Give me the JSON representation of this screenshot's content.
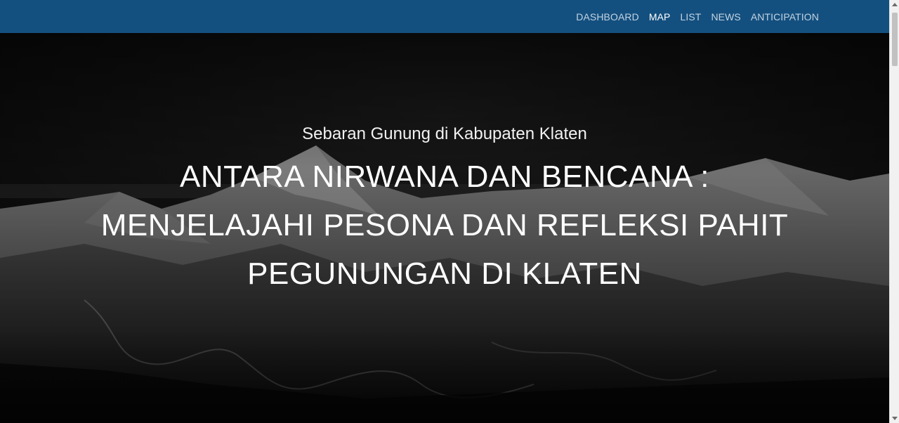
{
  "navbar": {
    "background": "#14507f",
    "items": [
      {
        "label": "DASHBOARD",
        "active": false
      },
      {
        "label": "MAP",
        "active": true
      },
      {
        "label": "LIST",
        "active": false
      },
      {
        "label": "NEWS",
        "active": false
      },
      {
        "label": "ANTICIPATION",
        "active": false
      }
    ]
  },
  "hero": {
    "subtitle": "Sebaran Gunung di Kabupaten Klaten",
    "title_lines": [
      "ANTARA NIRWANA DAN BENCANA :",
      "MENJELAJAHI PESONA DAN REFLEKSI PAHIT",
      "PEGUNUNGAN DI KLATEN"
    ],
    "background_image": "black-and-white-mountain-range-icon"
  }
}
